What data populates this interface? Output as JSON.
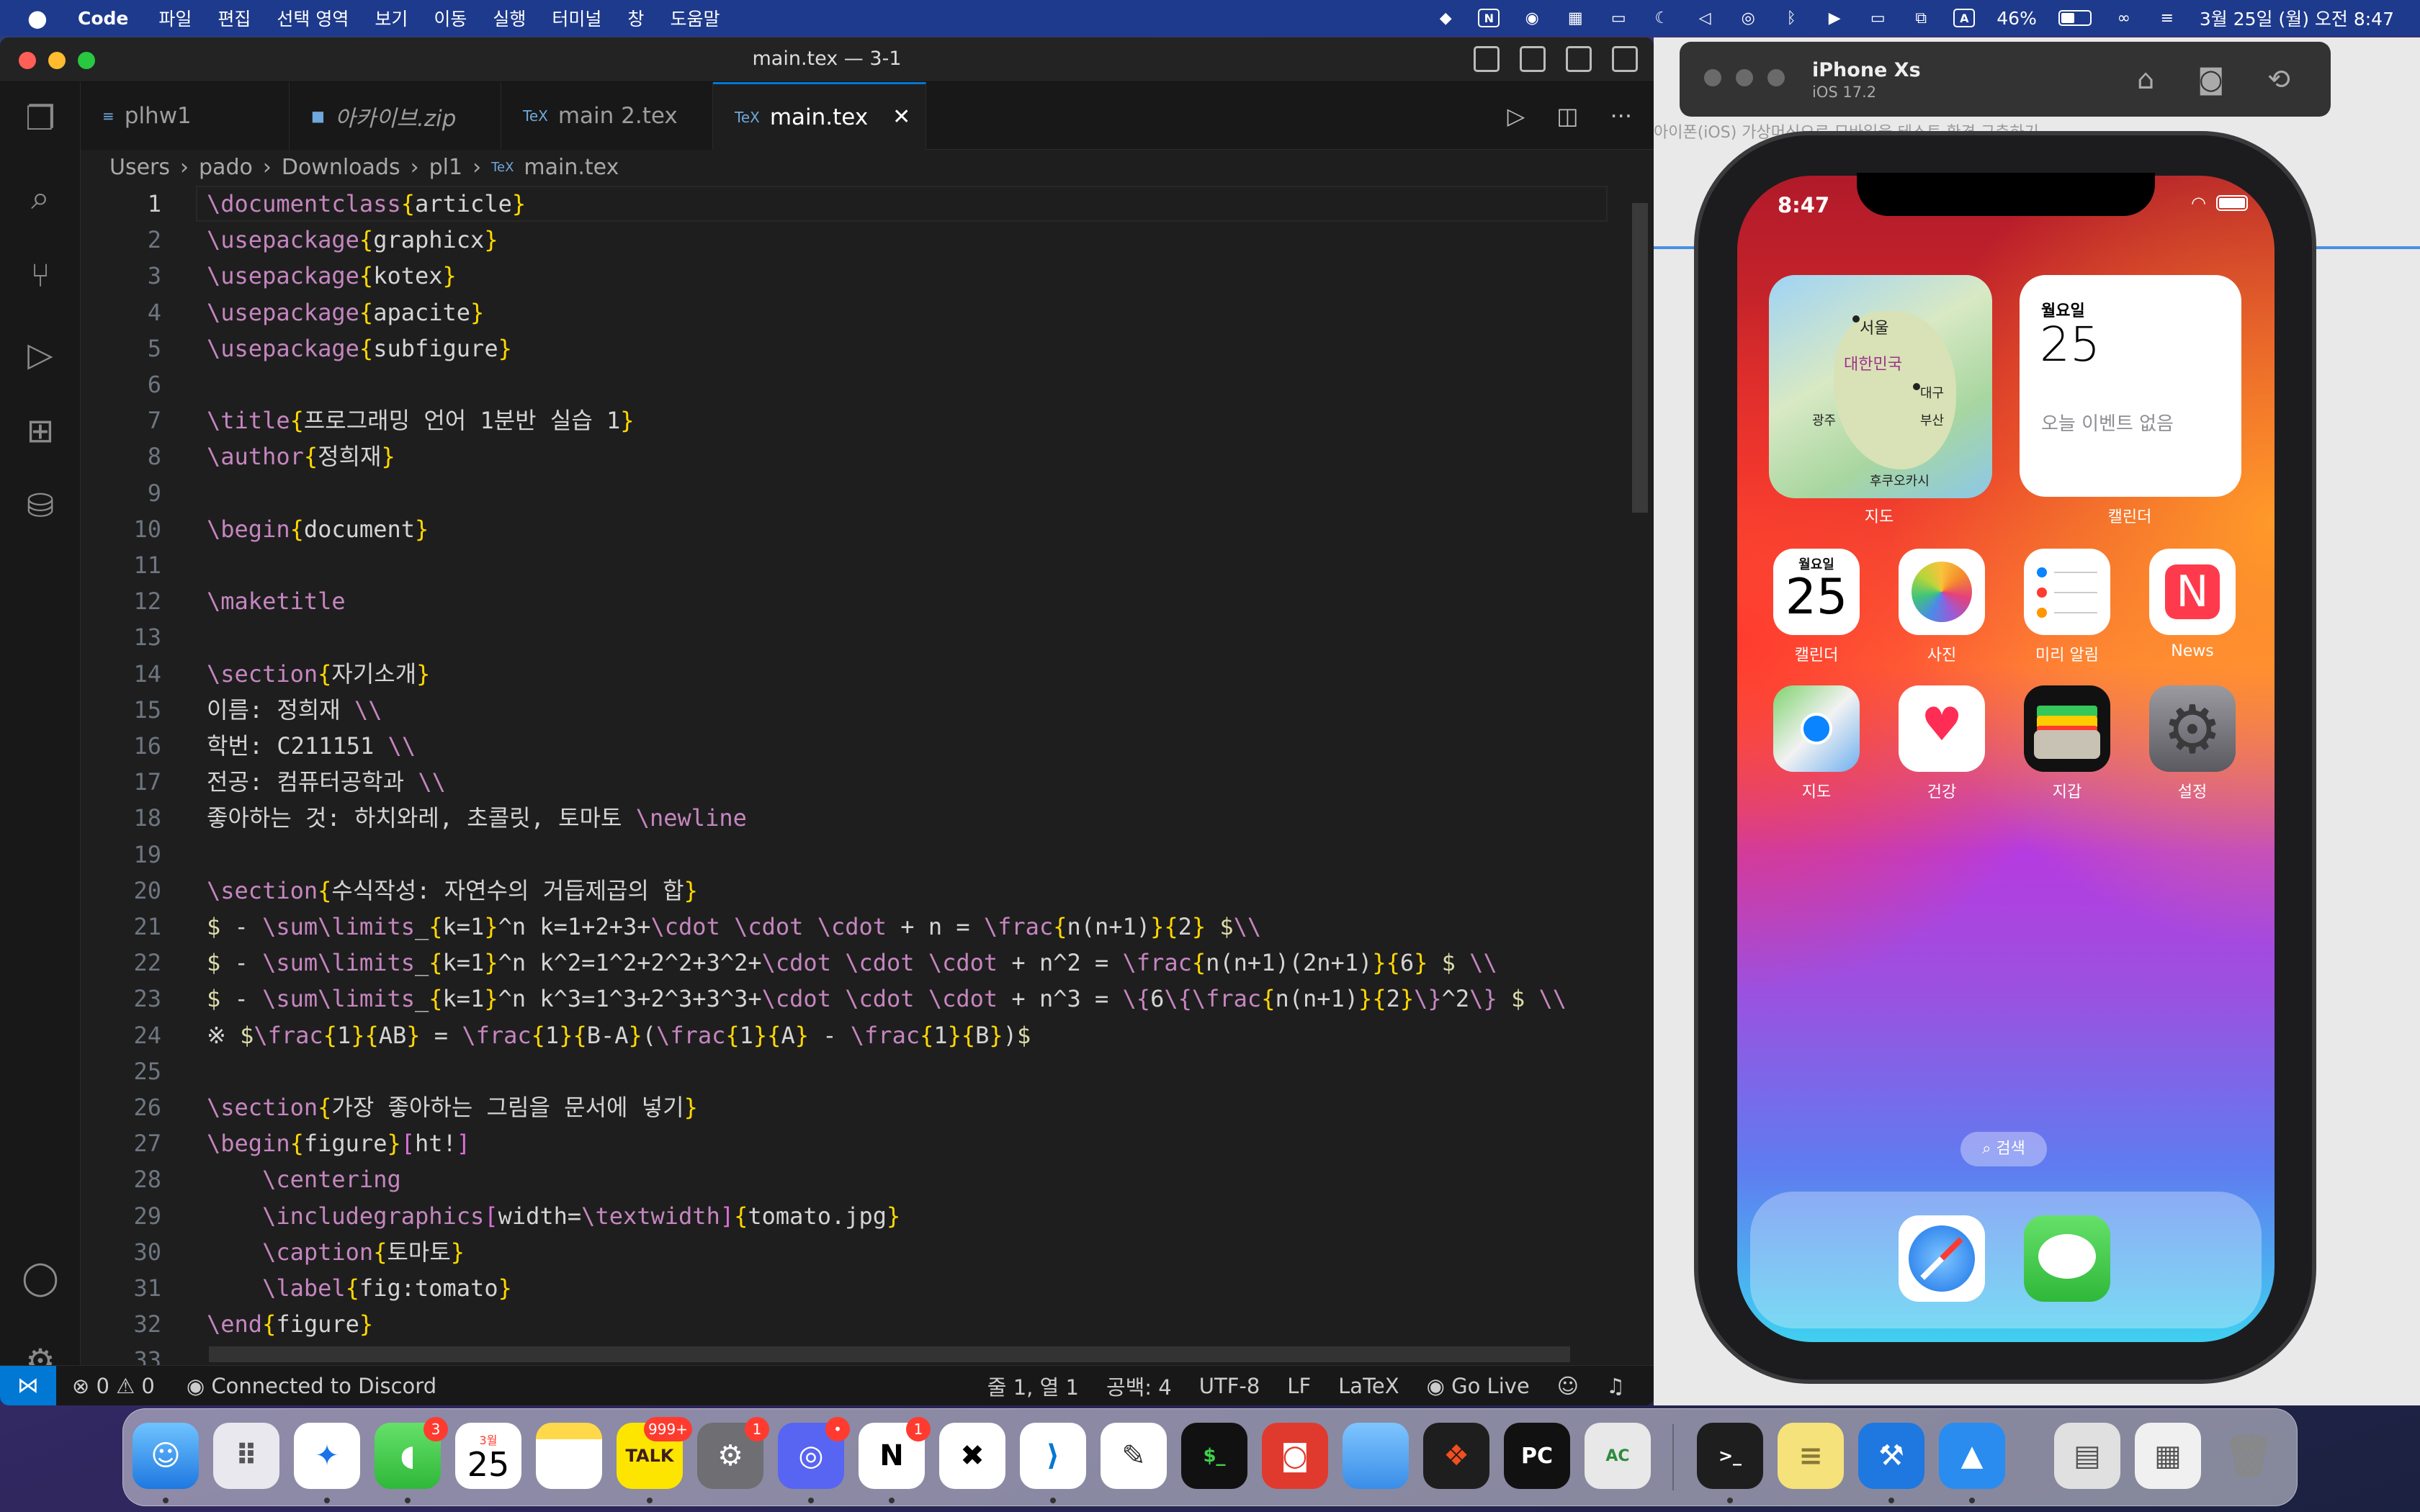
{
  "menubar": {
    "app_name": "Code",
    "menus": [
      "파일",
      "편집",
      "선택 영역",
      "보기",
      "이동",
      "실행",
      "터미널",
      "창",
      "도움말"
    ],
    "battery": "46%",
    "datetime": "3월 25일 (월) 오전 8:47"
  },
  "vscode": {
    "window_title": "main.tex — 3-1",
    "tabs": [
      {
        "label": "plhw1",
        "icon": "≡"
      },
      {
        "label": "아카이브.zip",
        "icon": "■"
      },
      {
        "label": "main 2.tex",
        "icon": "TeX"
      },
      {
        "label": "main.tex",
        "icon": "TeX"
      }
    ],
    "breadcrumb": [
      "Users",
      "pado",
      "Downloads",
      "pl1",
      "main.tex"
    ],
    "current_line": "1",
    "lines": [
      {
        "n": "1",
        "text": "\\documentclass{article}"
      },
      {
        "n": "2",
        "text": "\\usepackage{graphicx}"
      },
      {
        "n": "3",
        "text": "\\usepackage{kotex}"
      },
      {
        "n": "4",
        "text": "\\usepackage{apacite}"
      },
      {
        "n": "5",
        "text": "\\usepackage{subfigure}"
      },
      {
        "n": "6",
        "text": ""
      },
      {
        "n": "7",
        "text": "\\title{프로그래밍 언어 1분반 실습 1}"
      },
      {
        "n": "8",
        "text": "\\author{정희재}"
      },
      {
        "n": "9",
        "text": ""
      },
      {
        "n": "10",
        "text": "\\begin{document}"
      },
      {
        "n": "11",
        "text": ""
      },
      {
        "n": "12",
        "text": "\\maketitle"
      },
      {
        "n": "13",
        "text": ""
      },
      {
        "n": "14",
        "text": "\\section{자기소개}"
      },
      {
        "n": "15",
        "text": "이름: 정희재 \\\\"
      },
      {
        "n": "16",
        "text": "학번: C211151 \\\\"
      },
      {
        "n": "17",
        "text": "전공: 컴퓨터공학과 \\\\"
      },
      {
        "n": "18",
        "text": "좋아하는 것: 하치와레, 초콜릿, 토마토 \\newline"
      },
      {
        "n": "19",
        "text": ""
      },
      {
        "n": "20",
        "text": "\\section{수식작성: 자연수의 거듭제곱의 합}"
      },
      {
        "n": "21",
        "text": "$ - \\sum\\limits_{k=1}^n k=1+2+3+\\cdot \\cdot \\cdot + n = \\frac{n(n+1)}{2} $\\\\"
      },
      {
        "n": "22",
        "text": "$ - \\sum\\limits_{k=1}^n k^2=1^2+2^2+3^2+\\cdot \\cdot \\cdot + n^2 = \\frac{n(n+1)(2n+1)}{6} $ \\\\"
      },
      {
        "n": "23",
        "text": "$ - \\sum\\limits_{k=1}^n k^3=1^3+2^3+3^3+\\cdot \\cdot \\cdot + n^3 = \\{6\\{\\frac{n(n+1)}{2}\\}^2\\} $ \\\\"
      },
      {
        "n": "24",
        "text": "※ $\\frac{1}{AB} = \\frac{1}{B-A}(\\frac{1}{A} - \\frac{1}{B})$"
      },
      {
        "n": "25",
        "text": ""
      },
      {
        "n": "26",
        "text": "\\section{가장 좋아하는 그림을 문서에 넣기}"
      },
      {
        "n": "27",
        "text": "\\begin{figure}[ht!]"
      },
      {
        "n": "28",
        "text": "    \\centering"
      },
      {
        "n": "29",
        "text": "    \\includegraphics[width=\\textwidth]{tomato.jpg}"
      },
      {
        "n": "30",
        "text": "    \\caption{토마토}"
      },
      {
        "n": "31",
        "text": "    \\label{fig:tomato}"
      },
      {
        "n": "32",
        "text": "\\end{figure}"
      },
      {
        "n": "33",
        "text": ""
      }
    ],
    "status": {
      "errors": "0",
      "warnings": "0",
      "discord": "Connected to Discord",
      "position": "줄 1, 열 1",
      "spaces": "공백: 4",
      "encoding": "UTF-8",
      "eol": "LF",
      "language": "LaTeX",
      "golive": "Go Live"
    }
  },
  "simulator": {
    "device": "iPhone Xs",
    "os": "iOS 17.2",
    "background_text": "아이폰(iOS) 가상머신으로 모바일을 테스트 환경 구축하기",
    "phone": {
      "time": "8:47",
      "map_widget": {
        "label": "지도",
        "cities": [
          "서울",
          "대한민국",
          "대구",
          "광주",
          "부산",
          "후쿠오카시"
        ]
      },
      "calendar_widget": {
        "label": "캘린더",
        "day": "월요일",
        "date": "25",
        "event": "오늘 이벤트 없음"
      },
      "apps_row1": [
        {
          "label": "캘린더",
          "day": "월요일",
          "date": "25"
        },
        {
          "label": "사진"
        },
        {
          "label": "미리 알림"
        },
        {
          "label": "News"
        }
      ],
      "apps_row2": [
        {
          "label": "지도"
        },
        {
          "label": "건강"
        },
        {
          "label": "지갑"
        },
        {
          "label": "설정"
        }
      ],
      "search_label": "검색"
    }
  },
  "dock": {
    "badges": {
      "messages": "3",
      "kakaotalk": "999+",
      "settings": "1",
      "discord": "•",
      "notion": "1"
    },
    "calendar_month": "3월",
    "calendar_date": "25",
    "kakaotalk_label": "TALK"
  }
}
